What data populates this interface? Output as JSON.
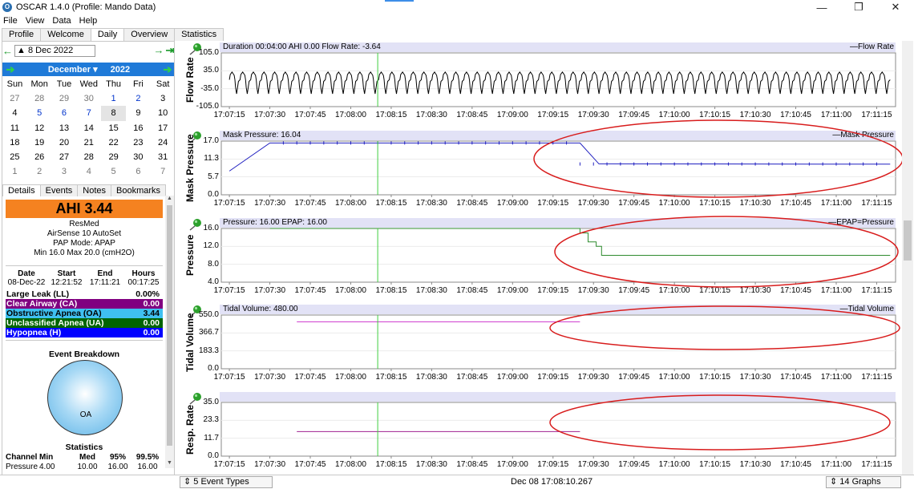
{
  "window": {
    "title": "OSCAR 1.4.0 (Profile: Mando Data)",
    "app_icon": "oscar-logo-icon",
    "controls": [
      "minimize-icon",
      "restore-icon",
      "close-icon"
    ]
  },
  "menu": [
    "File",
    "View",
    "Data",
    "Help"
  ],
  "tabs": [
    "Profile",
    "Welcome",
    "Daily",
    "Overview",
    "Statistics"
  ],
  "active_tab": "Daily",
  "sidebar": {
    "date": "8 Dec 2022",
    "calendar": {
      "month": "December",
      "year": "2022",
      "dow": [
        "Sun",
        "Mon",
        "Tue",
        "Wed",
        "Thu",
        "Fri",
        "Sat"
      ],
      "weeks": [
        [
          "27",
          "28",
          "29",
          "30",
          "1",
          "2",
          "3"
        ],
        [
          "4",
          "5",
          "6",
          "7",
          "8",
          "9",
          "10"
        ],
        [
          "11",
          "12",
          "13",
          "14",
          "15",
          "16",
          "17"
        ],
        [
          "18",
          "19",
          "20",
          "21",
          "22",
          "23",
          "24"
        ],
        [
          "25",
          "26",
          "27",
          "28",
          "29",
          "30",
          "31"
        ],
        [
          "1",
          "2",
          "3",
          "4",
          "5",
          "6",
          "7"
        ]
      ],
      "selected": "8"
    },
    "subtabs": [
      "Details",
      "Events",
      "Notes",
      "Bookmarks"
    ],
    "ahi": "AHI 3.44",
    "device_lines": [
      "ResMed",
      "AirSense 10 AutoSet",
      "PAP Mode: APAP",
      "Min 16.0 Max 20.0 (cmH2O)"
    ],
    "session_head": [
      "Date",
      "Start",
      "End",
      "Hours"
    ],
    "session_row": [
      "08-Dec-22",
      "12:21:52",
      "17:11:21",
      "00:17:25"
    ],
    "events": [
      {
        "label": "Large Leak (LL)",
        "value": "0.00%",
        "color": "#ffffff",
        "text": "#000000"
      },
      {
        "label": "Clear Airway (CA)",
        "value": "0.00",
        "color": "#800080",
        "text": "#ffffff"
      },
      {
        "label": "Obstructive Apnea (OA)",
        "value": "3.44",
        "color": "#3fc0f0",
        "text": "#000000"
      },
      {
        "label": "Unclassified Apnea (UA)",
        "value": "0.00",
        "color": "#006400",
        "text": "#ffffff"
      },
      {
        "label": "Hypopnea (H)",
        "value": "0.00",
        "color": "#0000ff",
        "text": "#ffffff"
      }
    ],
    "breakdown_title": "Event Breakdown",
    "pie_label": "OA",
    "stats_title": "Statistics",
    "stats_head": [
      "Channel",
      "Min",
      "Med",
      "95%",
      "99.5%"
    ],
    "stats_row": [
      "Pressure",
      "4.00",
      "10.00",
      "16.00",
      "16.00"
    ]
  },
  "status": {
    "events_combo": "5 Event Types",
    "center": "Dec 08 17:08:10.267",
    "graphs_combo": "14 Graphs"
  },
  "x_ticks": [
    "17:07:15",
    "17:07:30",
    "17:07:45",
    "17:08:00",
    "17:08:15",
    "17:08:30",
    "17:08:45",
    "17:09:00",
    "17:09:15",
    "17:09:30",
    "17:09:45",
    "17:10:00",
    "17:10:15",
    "17:10:30",
    "17:10:45",
    "17:11:00",
    "17:11:15"
  ],
  "chart_data": [
    {
      "type": "line",
      "ylabel": "Flow Rate",
      "header": "Duration 00:04:00 AHI 0.00 Flow Rate: -3.64",
      "legend": "Flow Rate",
      "yticks": [
        "105.0",
        "35.0",
        "-35.0",
        "-105.0"
      ],
      "ylim": [
        -105,
        105
      ],
      "color": "#000000",
      "series": [
        {
          "name": "Flow Rate",
          "pattern": "breathing",
          "x_start": "17:07:15",
          "x_end": "17:11:20",
          "amplitude_high": 30,
          "amplitude_low": -30,
          "breaths": 62
        }
      ]
    },
    {
      "type": "line",
      "ylabel": "Mask Pressure",
      "header": "Mask Pressure: 16.04",
      "legend": "Mask Pressure",
      "yticks": [
        "17.0",
        "11.3",
        "5.7",
        "0.0"
      ],
      "ylim": [
        0,
        17
      ],
      "color": "#2020c0",
      "series": [
        {
          "name": "Mask Pressure",
          "points": [
            [
              "17:07:15",
              7.5
            ],
            [
              "17:07:30",
              16.4
            ],
            [
              "17:09:25",
              16.4
            ],
            [
              "17:09:32",
              9.8
            ],
            [
              "17:11:20",
              9.7
            ]
          ]
        }
      ]
    },
    {
      "type": "line",
      "ylabel": "Pressure",
      "header": "Pressure: 16.00 EPAP: 16.00",
      "legend": "EPAP=Pressure",
      "yticks": [
        "16.0",
        "12.0",
        "8.0",
        "4.0"
      ],
      "ylim": [
        4,
        16
      ],
      "color": "#2e8b2e",
      "series": [
        {
          "name": "EPAP=Pressure",
          "points": [
            [
              "17:07:30",
              16
            ],
            [
              "17:09:25",
              16
            ],
            [
              "17:09:25",
              15
            ],
            [
              "17:09:28",
              15
            ],
            [
              "17:09:28",
              13
            ],
            [
              "17:09:31",
              13
            ],
            [
              "17:09:31",
              12
            ],
            [
              "17:09:33",
              12
            ],
            [
              "17:09:33",
              10
            ],
            [
              "17:11:20",
              10
            ]
          ]
        }
      ]
    },
    {
      "type": "line",
      "ylabel": "Tidal Volume",
      "header": "Tidal Volume: 480.00",
      "legend": "Tidal Volume",
      "yticks": [
        "550.0",
        "366.7",
        "183.3",
        "0.0"
      ],
      "ylim": [
        0,
        550
      ],
      "color": "#d040d0",
      "series": [
        {
          "name": "Tidal Volume",
          "points": [
            [
              "17:07:40",
              480
            ],
            [
              "17:09:25",
              480
            ]
          ]
        }
      ]
    },
    {
      "type": "line",
      "ylabel": "Resp. Rate",
      "header": "",
      "legend": "",
      "yticks": [
        "35.0",
        "23.3",
        "11.7",
        "0.0"
      ],
      "ylim": [
        0,
        35
      ],
      "color": "#a02090",
      "series": [
        {
          "name": "Resp. Rate",
          "points": [
            [
              "17:07:40",
              16
            ],
            [
              "17:09:25",
              16
            ]
          ]
        }
      ]
    }
  ]
}
